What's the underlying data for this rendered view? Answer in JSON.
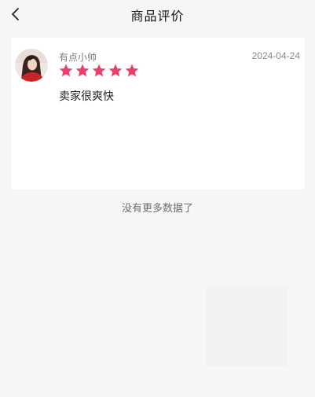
{
  "header": {
    "title": "商品评价",
    "back_icon": "chevron-left-icon"
  },
  "review": {
    "avatar_icon": "user-avatar",
    "username": "有点小帅",
    "date": "2024-04-24",
    "rating": 5,
    "rating_max": 5,
    "star_color": "#ee3f6a",
    "text": "卖家很爽快"
  },
  "list_end_text": "没有更多数据了"
}
